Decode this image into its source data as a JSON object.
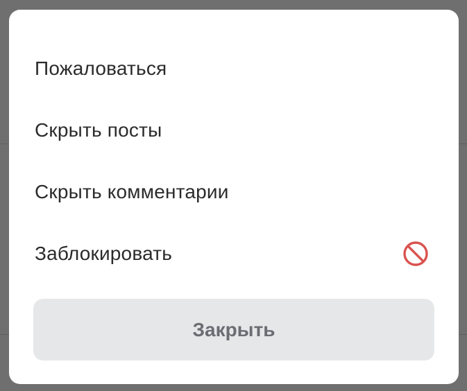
{
  "menu": {
    "items": [
      {
        "label": "Пожаловаться"
      },
      {
        "label": "Скрыть посты"
      },
      {
        "label": "Скрыть комментарии"
      },
      {
        "label": "Заблокировать",
        "icon": "block-icon"
      }
    ]
  },
  "close_button": {
    "label": "Закрыть"
  },
  "colors": {
    "backdrop": "#6f6f6f",
    "sheet": "#ffffff",
    "item_text": "#2b2b2b",
    "block_icon": "#d9534f",
    "close_button_bg": "#e6e7e9",
    "close_button_text": "#6a6d72"
  }
}
